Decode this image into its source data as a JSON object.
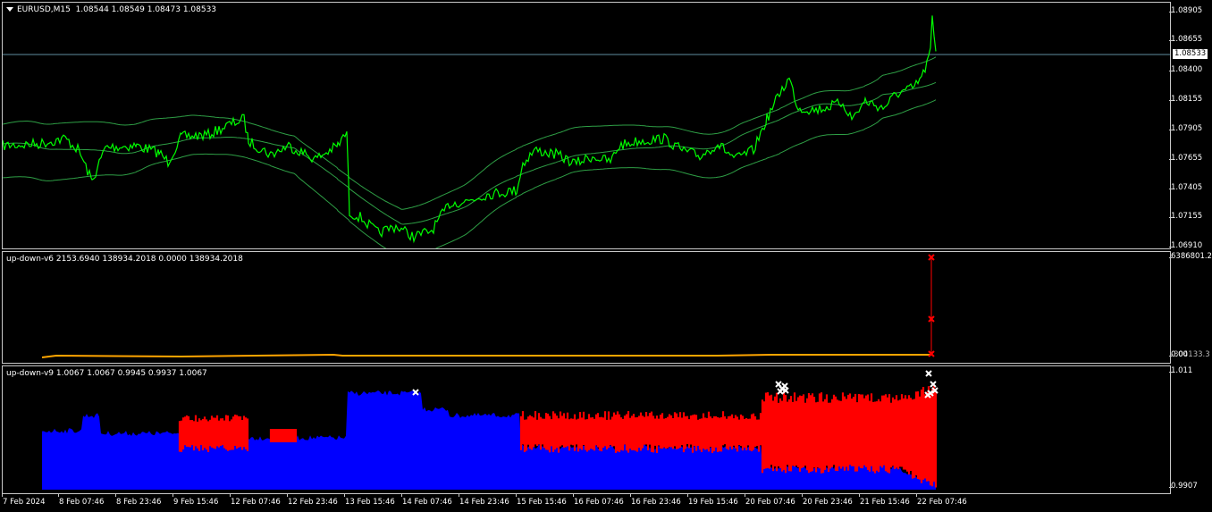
{
  "main": {
    "symbol": "EURUSD,M15",
    "ohlc": "1.08544 1.08549 1.08473 1.08533",
    "axis_labels": [
      "1.08905",
      "1.08655",
      "1.08400",
      "1.08155",
      "1.07905",
      "1.07655",
      "1.07405",
      "1.07155",
      "1.06910"
    ],
    "current_price": "1.08533",
    "colors": {
      "price_line": "#00ff00",
      "bands": "#2e9e45",
      "hline": "#5f8ea0"
    }
  },
  "indicator1": {
    "title": "up-down-v6 2153.6940 138934.2018 0.0000 138934.2018",
    "axis_labels": [
      "6386801.2",
      "0.00"
    ],
    "axis_overlap": "-304133.3",
    "colors": {
      "line": "#ffa500",
      "markers": "#ff0000"
    }
  },
  "indicator2": {
    "title": "up-down-v9 1.0067 1.0067 0.9945 0.9937 1.0067",
    "axis_labels": [
      "1.011",
      "0.9907"
    ],
    "colors": {
      "up": "#0000ff",
      "down": "#ff0000",
      "markers": "#ffffff"
    }
  },
  "time_axis": [
    "7 Feb 2024",
    "8 Feb 07:46",
    "8 Feb 23:46",
    "9 Feb 15:46",
    "12 Feb 07:46",
    "12 Feb 23:46",
    "13 Feb 15:46",
    "14 Feb 07:46",
    "14 Feb 23:46",
    "15 Feb 15:46",
    "16 Feb 07:46",
    "16 Feb 23:46",
    "19 Feb 15:46",
    "20 Feb 07:46",
    "20 Feb 23:46",
    "21 Feb 15:46",
    "22 Feb 07:46"
  ]
}
